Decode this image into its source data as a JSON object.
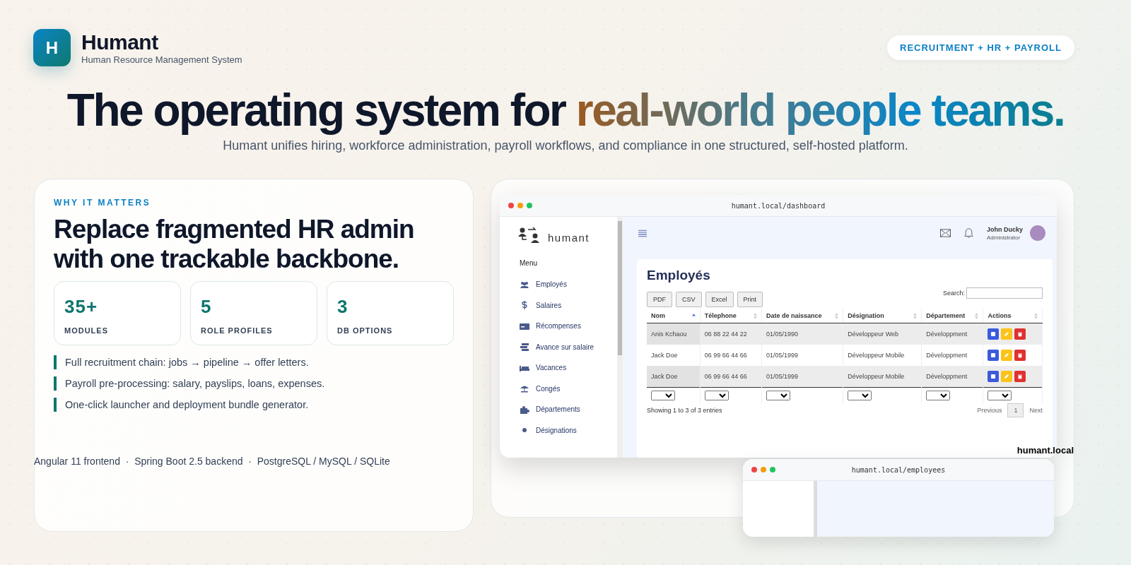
{
  "brand": {
    "logo_letter": "H",
    "name": "Humant",
    "tagline": "Human Resource Management System"
  },
  "badge": "RECRUITMENT + HR + PAYROLL",
  "hero": {
    "headline": "The operating system for ",
    "highlight": "real-world people teams.",
    "subtitle": "Humant unifies hiring, workforce administration, payroll workflows, and compliance in one structured, self-hosted platform."
  },
  "why": {
    "eyebrow": "WHY IT MATTERS",
    "title": "Replace fragmented HR admin with one trackable backbone.",
    "stats": [
      {
        "value": "35+",
        "label": "MODULES"
      },
      {
        "value": "5",
        "label": "ROLE PROFILES"
      },
      {
        "value": "3",
        "label": "DB OPTIONS"
      }
    ],
    "points": [
      "Full recruitment chain: jobs → pipeline → offer letters.",
      "Payroll pre-processing: salary, payslips, loans, expenses.",
      "One-click launcher and deployment bundle generator."
    ]
  },
  "tech_line": "Angular 11 frontend  ·  Spring Boot 2.5 backend  ·  PostgreSQL / MySQL / SQLite",
  "preview": {
    "caption": "humant.local",
    "main_window": {
      "url": "humant.local/dashboard",
      "logo_text": "humant",
      "menu_label": "Menu",
      "nav": [
        {
          "label": "Employés",
          "kind": "users"
        },
        {
          "label": "Salaires",
          "kind": "money"
        },
        {
          "label": "Récompenses",
          "kind": "card"
        },
        {
          "label": "Avance sur salaire",
          "kind": "stack"
        },
        {
          "label": "Vacances",
          "kind": "bed"
        },
        {
          "label": "Congés",
          "kind": "umbrella"
        },
        {
          "label": "Départements",
          "kind": "puzzle"
        },
        {
          "label": "Désignations",
          "kind": "dot"
        }
      ],
      "user": {
        "name": "John Ducky",
        "role": "Administrator"
      },
      "page_title": "Employés",
      "export_buttons": [
        "PDF",
        "CSV",
        "Excel",
        "Print"
      ],
      "search_label": "Search:",
      "columns": [
        {
          "label": "Nom",
          "selected": true
        },
        {
          "label": "Télephone",
          "selected": false
        },
        {
          "label": "Date de naissance",
          "selected": false
        },
        {
          "label": "Désignation",
          "selected": false
        },
        {
          "label": "Département",
          "selected": false
        },
        {
          "label": "Actions",
          "selected": false
        }
      ],
      "rows": [
        {
          "cells": [
            "Anis Kchaou",
            "06 88 22 44 22",
            "01/05/1990",
            "Développeur Web",
            "Développment"
          ],
          "striped": true
        },
        {
          "cells": [
            "Jack Doe",
            "06 99 66 44 66",
            "01/05/1999",
            "Développeur Mobile",
            "Développment"
          ],
          "striped": false
        },
        {
          "cells": [
            "Jack Doe",
            "06 99 66 44 66",
            "01/05/1999",
            "Développeur Mobile",
            "Développment"
          ],
          "striped": true
        }
      ],
      "info": "Showing 1 to 3 of 3 entries",
      "pagination": {
        "previous": "Previous",
        "pages": [
          {
            "label": "1",
            "selected": true
          }
        ],
        "next": "Next"
      }
    },
    "second_window": {
      "url": "humant.local/employees"
    }
  }
}
